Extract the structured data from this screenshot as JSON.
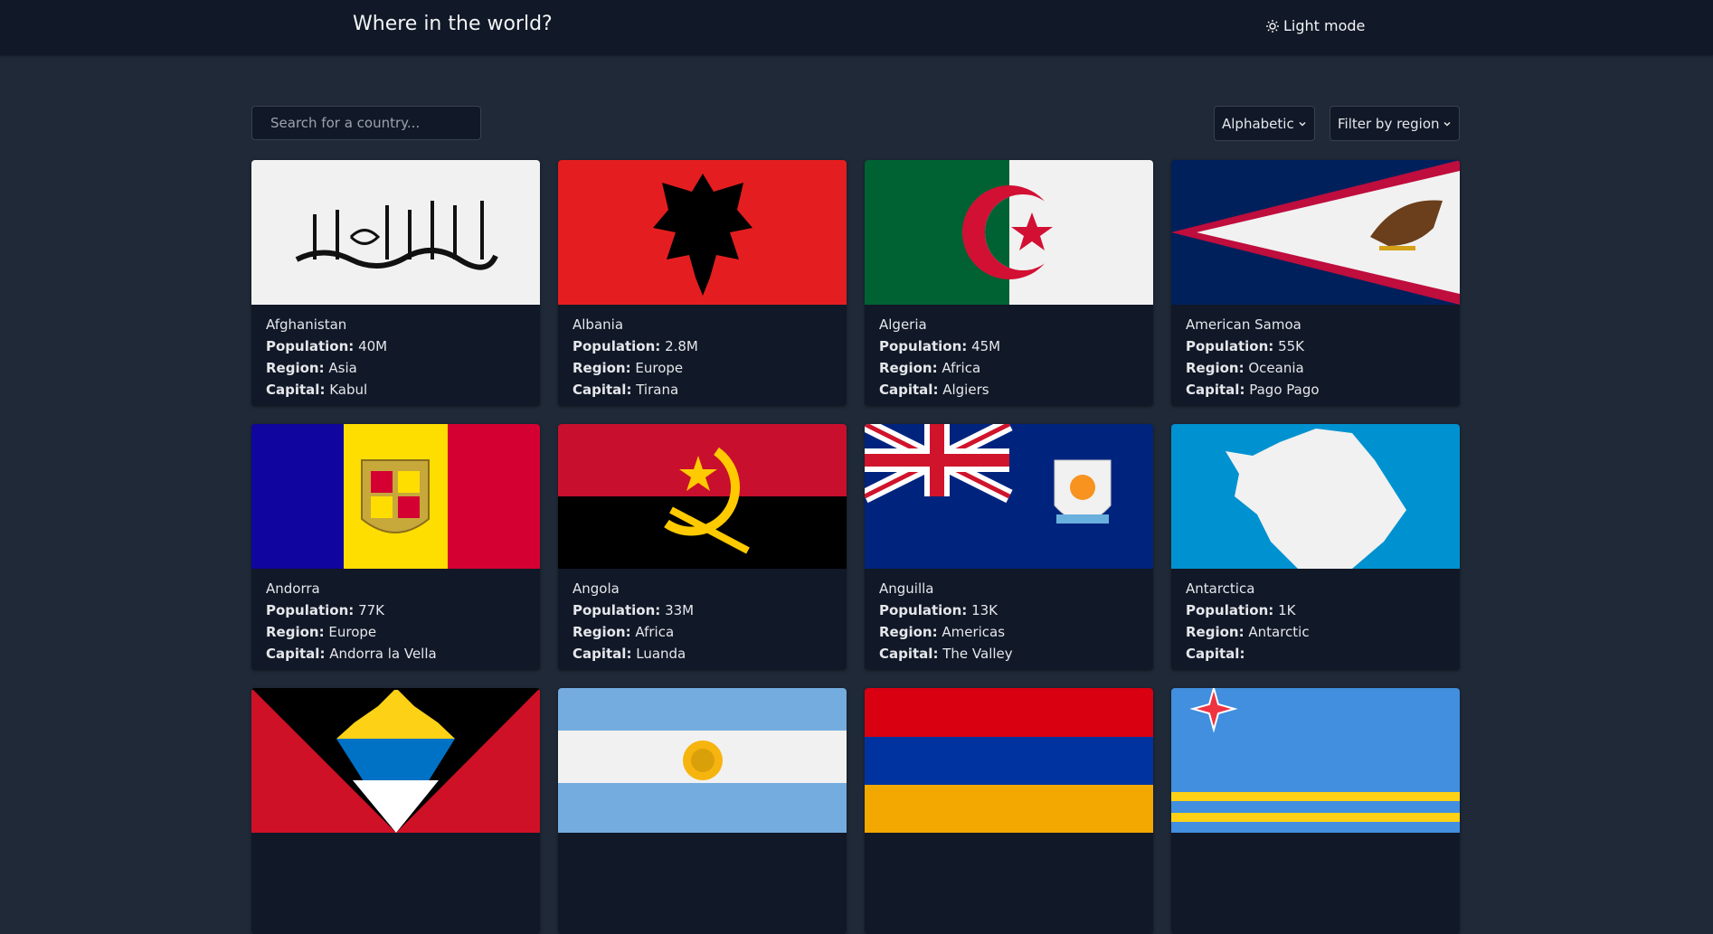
{
  "header": {
    "title": "Where in the world?",
    "mode_label": "Light mode"
  },
  "controls": {
    "search_placeholder": "Search for a country...",
    "sort_selected": "Alphabetic",
    "region_selected": "Filter by region"
  },
  "labels": {
    "population": "Population:",
    "region": "Region:",
    "capital": "Capital:"
  },
  "countries": [
    {
      "name": "Afghanistan",
      "population": "40M",
      "region": "Asia",
      "capital": "Kabul"
    },
    {
      "name": "Albania",
      "population": "2.8M",
      "region": "Europe",
      "capital": "Tirana"
    },
    {
      "name": "Algeria",
      "population": "45M",
      "region": "Africa",
      "capital": "Algiers"
    },
    {
      "name": "American Samoa",
      "population": "55K",
      "region": "Oceania",
      "capital": "Pago Pago"
    },
    {
      "name": "Andorra",
      "population": "77K",
      "region": "Europe",
      "capital": "Andorra la Vella"
    },
    {
      "name": "Angola",
      "population": "33M",
      "region": "Africa",
      "capital": "Luanda"
    },
    {
      "name": "Anguilla",
      "population": "13K",
      "region": "Americas",
      "capital": "The Valley"
    },
    {
      "name": "Antarctica",
      "population": "1K",
      "region": "Antarctic",
      "capital": ""
    }
  ]
}
